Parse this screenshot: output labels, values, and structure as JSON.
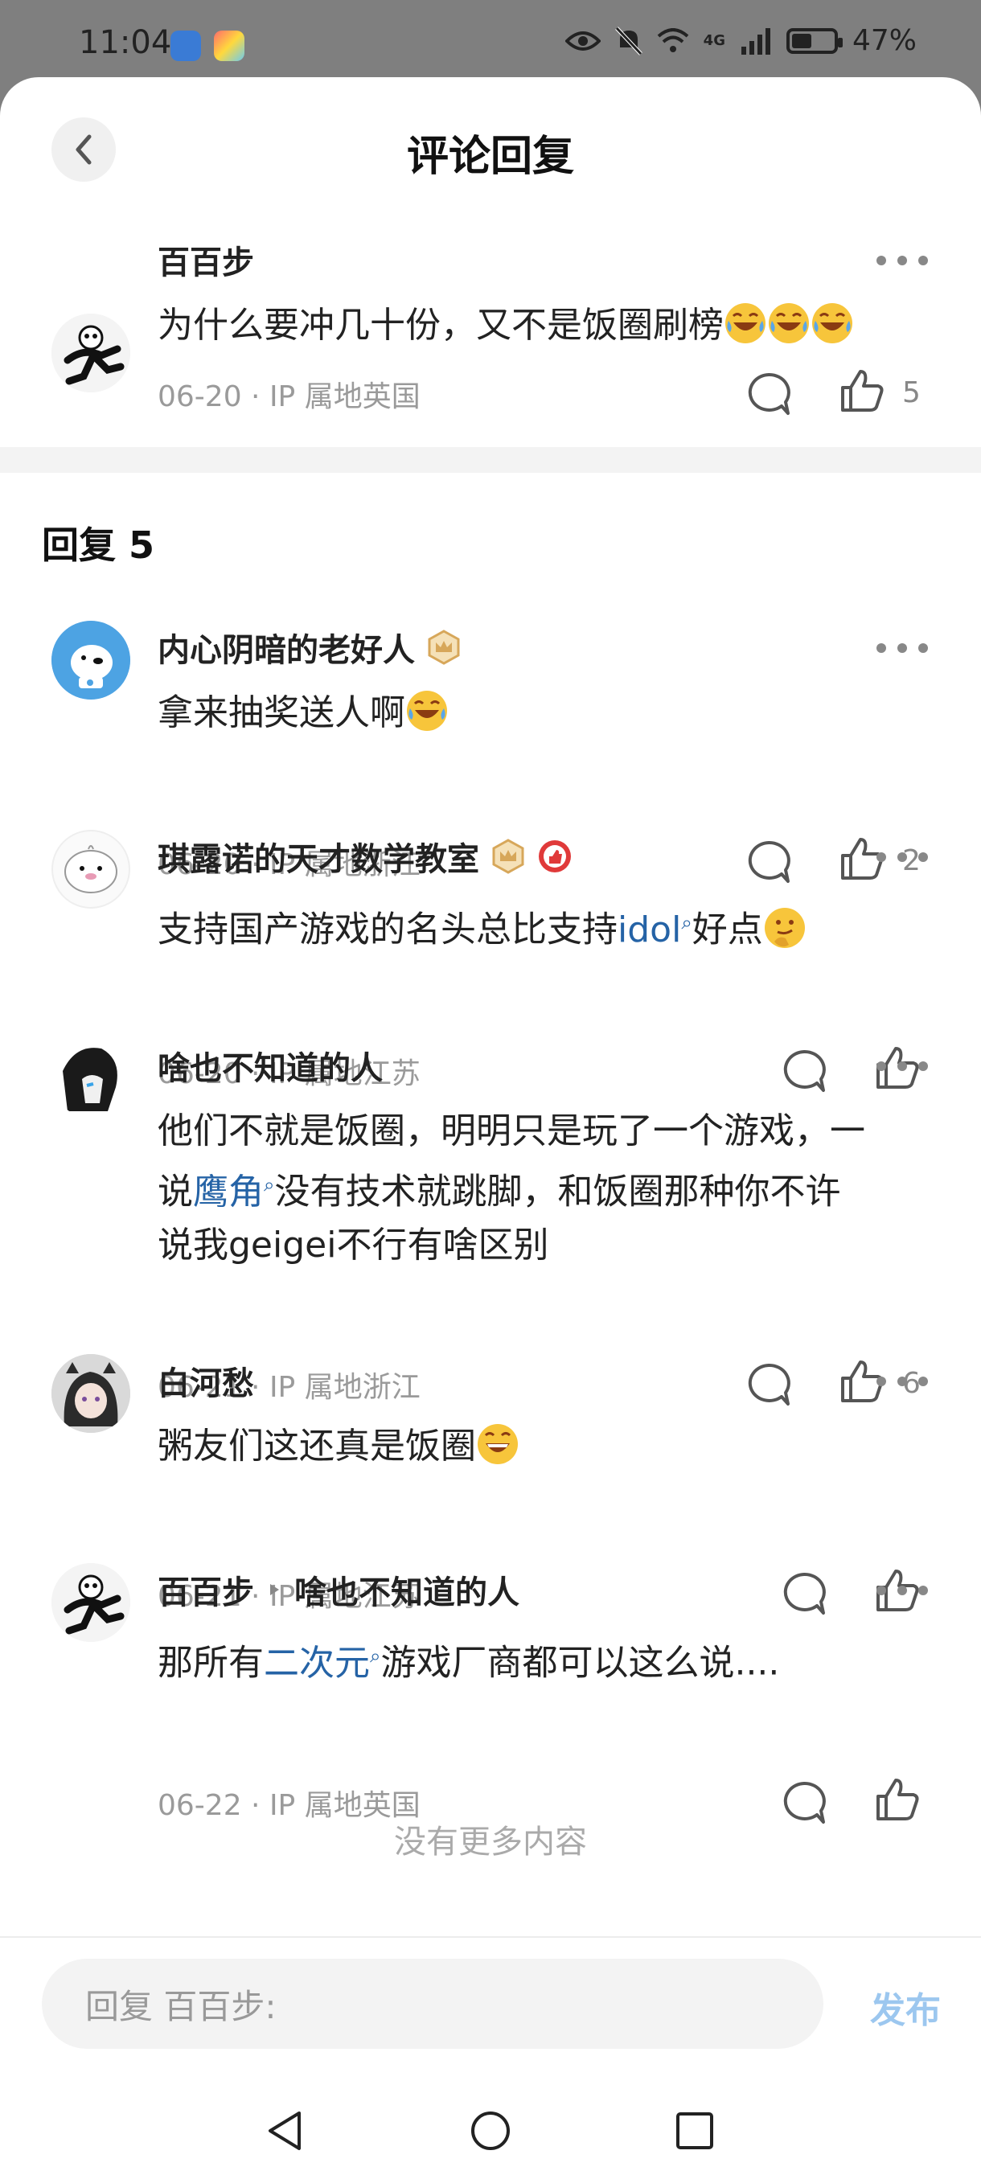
{
  "status_bar": {
    "time": "11:04",
    "network": "4G",
    "battery_percent": 47,
    "battery_label": "47%"
  },
  "header": {
    "title": "评论回复",
    "back_icon": "chevron-left-icon"
  },
  "main_comment": {
    "author": "百百步",
    "text": "为什么要冲几十份，又不是饭圈刷榜",
    "emoji": "laugh-cry x3",
    "meta": "06-20 · IP 属地英国",
    "likes": "5"
  },
  "replies_heading": "回复 5",
  "replies": [
    {
      "author": "内心阴暗的老好人",
      "text": "拿来抽奖送人啊",
      "meta": "06-20 · IP 属地浙江",
      "likes": "2"
    },
    {
      "author": "琪露诺的天才数学教室",
      "text_before": "支持国产游戏的名头总比支持",
      "keyword": "idol",
      "text_after": "好点",
      "meta": "06-20 · IP 属地江苏",
      "likes": ""
    },
    {
      "author": "啥也不知道的人",
      "text_line1": "他们不就是饭圈，明明只是玩了一个游戏，一",
      "text_prefix": "说",
      "keyword": "鹰角",
      "text_line2_after": "没有技术就跳脚，和饭圈那种你不许",
      "text_line3": "说我geigei不行有啥区别",
      "meta": "06-21 · IP 属地浙江",
      "likes": "6"
    },
    {
      "author": "白河愁",
      "text": "粥友们这还真是饭圈",
      "meta": "06-21 · IP 属地江苏",
      "likes": ""
    },
    {
      "author": "百百步",
      "reply_to": "啥也不知道的人",
      "text_before": "那所有",
      "keyword": "二次元",
      "text_after": "游戏厂商都可以这么说....",
      "meta": "06-22 · IP 属地英国",
      "likes": ""
    }
  ],
  "no_more": "没有更多内容",
  "input": {
    "placeholder": "回复 百百步:",
    "publish_label": "发布"
  },
  "colors": {
    "keyword": "#2563a6",
    "publish": "#9cc7ef"
  }
}
